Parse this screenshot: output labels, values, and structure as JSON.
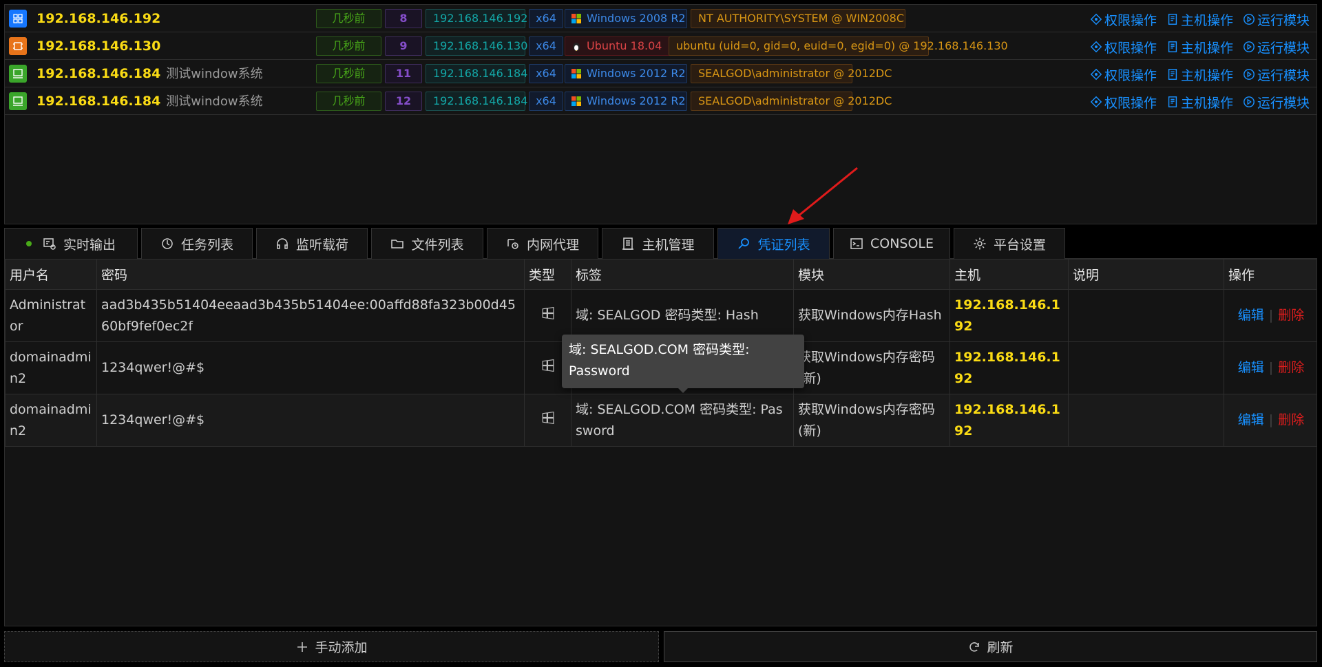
{
  "sessions": [
    {
      "host": "192.168.146.192",
      "note": "",
      "time": "几秒前",
      "id": "8",
      "ip": "192.168.146.192",
      "arch": "x64",
      "os": "Windows 2008 R2",
      "user": "NT AUTHORITY\\SYSTEM @ WIN2008C",
      "icon_color": "#1677ff"
    },
    {
      "host": "192.168.146.130",
      "note": "",
      "time": "几秒前",
      "id": "9",
      "ip": "192.168.146.130",
      "arch": "x64",
      "os": "Ubuntu 18.04",
      "user": "ubuntu (uid=0, gid=0, euid=0, egid=0) @ 192.168.146.130",
      "icon_color": "#e8741a"
    },
    {
      "host": "192.168.146.184",
      "note": "测试window系统",
      "time": "几秒前",
      "id": "11",
      "ip": "192.168.146.184",
      "arch": "x64",
      "os": "Windows 2012 R2",
      "user": "SEALGOD\\administrator @ 2012DC",
      "icon_color": "#3aa52a"
    },
    {
      "host": "192.168.146.184",
      "note": "测试window系统",
      "time": "几秒前",
      "id": "12",
      "ip": "192.168.146.184",
      "arch": "x64",
      "os": "Windows 2012 R2",
      "user": "SEALGOD\\administrator @ 2012DC",
      "icon_color": "#3aa52a"
    }
  ],
  "session_actions": {
    "privilege": "权限操作",
    "host": "主机操作",
    "module": "运行模块"
  },
  "tabs": [
    {
      "label": "实时输出",
      "icon": "output-icon"
    },
    {
      "label": "任务列表",
      "icon": "history-icon"
    },
    {
      "label": "监听载荷",
      "icon": "headphones-icon"
    },
    {
      "label": "文件列表",
      "icon": "folder-icon"
    },
    {
      "label": "内网代理",
      "icon": "proxy-icon"
    },
    {
      "label": "主机管理",
      "icon": "host-icon"
    },
    {
      "label": "凭证列表",
      "icon": "key-icon"
    },
    {
      "label": "CONSOLE",
      "icon": "terminal-icon"
    },
    {
      "label": "平台设置",
      "icon": "gear-icon"
    }
  ],
  "active_tab": "凭证列表",
  "cred_table": {
    "headers": [
      "用户名",
      "密码",
      "类型",
      "标签",
      "模块",
      "主机",
      "说明",
      "操作"
    ],
    "rows": [
      {
        "user": "Administrator",
        "password": "aad3b435b51404eeaad3b435b51404ee:00affd88fa323b00d4560bf9fef0ec2f",
        "type_icon": "windows-icon",
        "tag": "域: SEALGOD 密码类型: Hash",
        "module": "获取Windows内存Hash",
        "host": "192.168.146.192",
        "note": ""
      },
      {
        "user": "domainadmin2",
        "password": "1234qwer!@#$",
        "type_icon": "windows-icon",
        "tag": "域: SEALGOD.COM 密码类型: Password",
        "module": "获取Windows内存密码(新)",
        "host": "192.168.146.192",
        "note": ""
      },
      {
        "user": "domainadmin2",
        "password": "1234qwer!@#$",
        "type_icon": "windows-icon",
        "tag": "域: SEALGOD.COM 密码类型: Password",
        "module": "获取Windows内存密码(新)",
        "host": "192.168.146.192",
        "note": ""
      }
    ],
    "op_edit": "编辑",
    "op_delete": "删除"
  },
  "tooltip": {
    "text": "域: SEALGOD.COM 密码类型: Password"
  },
  "buttons": {
    "add": "手动添加",
    "refresh": "刷新"
  },
  "colors": {
    "accent": "#1890ff",
    "host_ip": "#fadb14",
    "danger": "#dc1d1d",
    "annotation": "#e01b1b"
  }
}
